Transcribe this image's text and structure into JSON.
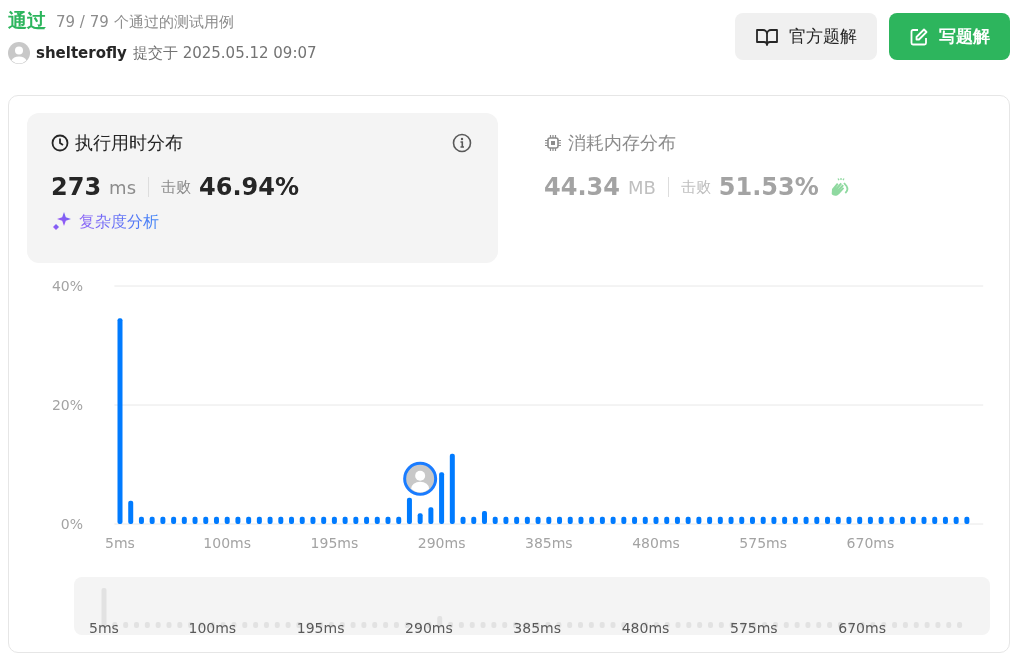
{
  "status": {
    "label": "通过",
    "cases": "79 / 79 个通过的测试用例"
  },
  "submitter": {
    "name": "shelterofly",
    "submitted": "提交于 2025.05.12 09:07"
  },
  "buttons": [
    {
      "label": "官方题解",
      "kind": "secondary"
    },
    {
      "label": "写题解",
      "kind": "primary"
    }
  ],
  "stats": [
    {
      "kind": "runtime",
      "title": "执行用时分布",
      "value": "273",
      "unit": "ms",
      "beats_label": "击败",
      "beats": "46.94%",
      "selected": true,
      "link": "复杂度分析"
    },
    {
      "kind": "memory",
      "title": "消耗内存分布",
      "value": "44.34",
      "unit": "MB",
      "beats_label": "击败",
      "beats": "51.53%",
      "selected": false
    }
  ],
  "chart": {
    "chart_data": {
      "type": "bar",
      "x": [
        5,
        14.5,
        24,
        33.5,
        43,
        52.5,
        62,
        71.5,
        81,
        90.5,
        100,
        109.5,
        119,
        128.5,
        138,
        147.5,
        157,
        166.5,
        176,
        185.5,
        195,
        204.5,
        214,
        223.5,
        233,
        242.5,
        252,
        261.5,
        271,
        280.5,
        290,
        299.5,
        309,
        318.5,
        328,
        337.5,
        347,
        356.5,
        366,
        375.5,
        385,
        394.5,
        404,
        413.5,
        423,
        432.5,
        442,
        451.5,
        461,
        470.5,
        480,
        489.5,
        499,
        508.5,
        518,
        527.5,
        537,
        546.5,
        556,
        565.5,
        575,
        584.5,
        594,
        603.5,
        613,
        622.5,
        632,
        641.5,
        651,
        660.5,
        670,
        679.5,
        689,
        698.5,
        708,
        717.5,
        727,
        736.5,
        746,
        755.5
      ],
      "series": [
        {
          "color": "#007bff",
          "values": [
            34.6,
            3.9,
            1.2,
            1.2,
            1.2,
            1.2,
            1.2,
            1.2,
            1.2,
            1.2,
            1.2,
            1.2,
            1.2,
            1.2,
            1.2,
            1.2,
            1.2,
            1.2,
            1.2,
            1.2,
            1.2,
            1.2,
            1.2,
            1.2,
            1.2,
            1.2,
            1.2,
            4.4,
            1.8,
            2.8,
            8.7,
            11.8,
            1.2,
            1.2,
            2.2,
            1.2,
            1.2,
            1.2,
            1.2,
            1.2,
            1.2,
            1.2,
            1.2,
            1.2,
            1.2,
            1.2,
            1.2,
            1.2,
            1.2,
            1.2,
            1.2,
            1.2,
            1.2,
            1.2,
            1.2,
            1.2,
            1.2,
            1.2,
            1.2,
            1.2,
            1.2,
            1.2,
            1.2,
            1.2,
            1.2,
            1.2,
            1.2,
            1.2,
            1.2,
            1.2,
            1.2,
            1.2,
            1.2,
            1.2,
            1.2,
            1.2,
            1.2,
            1.2,
            1.2,
            1.2
          ]
        }
      ],
      "xlim": [
        0,
        770
      ],
      "ylim": [
        0,
        40
      ],
      "yticks": [
        {
          "value": 0,
          "label": "0%"
        },
        {
          "value": 20,
          "label": "20%"
        },
        {
          "value": 40,
          "label": "40%"
        }
      ],
      "xticks": [
        {
          "value": 5,
          "label": "5ms"
        },
        {
          "value": 100,
          "label": "100ms"
        },
        {
          "value": 195,
          "label": "195ms"
        },
        {
          "value": 290,
          "label": "290ms"
        },
        {
          "value": 385,
          "label": "385ms"
        },
        {
          "value": 480,
          "label": "480ms"
        },
        {
          "value": 575,
          "label": "575ms"
        },
        {
          "value": 670,
          "label": "670ms"
        }
      ]
    },
    "navigator": {
      "labels": [
        "5ms",
        "100ms",
        "195ms",
        "290ms",
        "385ms",
        "480ms",
        "575ms",
        "670ms"
      ]
    }
  }
}
